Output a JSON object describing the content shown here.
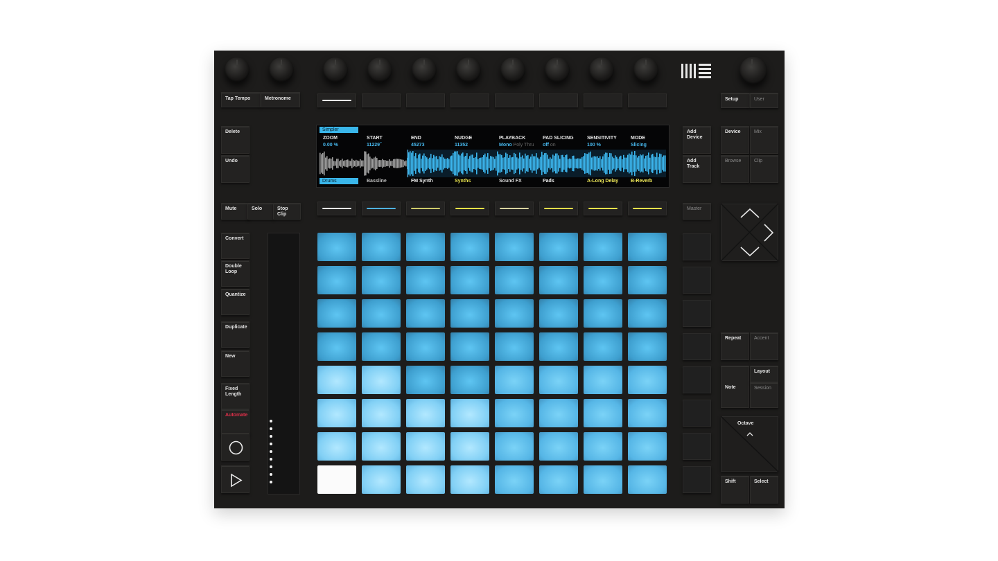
{
  "controller": {
    "logo": "ableton-logo",
    "top_left_buttons": [
      "Tap Tempo",
      "Metronome"
    ],
    "right_top": {
      "setup": "Setup",
      "user": "User"
    },
    "left_buttons": {
      "delete": "Delete",
      "undo": "Undo",
      "mute": "Mute",
      "solo": "Solo",
      "stop_clip": "Stop\nClip",
      "convert": "Convert",
      "double_loop": "Double\nLoop",
      "quantize": "Quantize",
      "duplicate": "Duplicate",
      "new": "New",
      "fixed_length": "Fixed\nLength",
      "automate": "Automate",
      "record_icon": "record-icon",
      "play_icon": "play-icon"
    },
    "screen": {
      "device_tag": "Simpler",
      "track_tag": "Drums",
      "params": [
        {
          "name": "ZOOM",
          "value": "0.00 %"
        },
        {
          "name": "START",
          "value": "11229˝"
        },
        {
          "name": "END",
          "value": "45273"
        },
        {
          "name": "NUDGE",
          "value": "11352"
        },
        {
          "name": "PLAYBACK",
          "value": "Mono",
          "extra": "Poly Thru"
        },
        {
          "name": "PAD SLICING",
          "value": "off",
          "extra": "on"
        },
        {
          "name": "SENSITIVITY",
          "value": "100 %"
        },
        {
          "name": "MODE",
          "value": "Slicing"
        }
      ],
      "tracks": [
        "Drums",
        "Bassline",
        "FM Synth",
        "Synths",
        "Sound FX",
        "Pads",
        "A-Long Delay",
        "B-Reverb"
      ],
      "track_colors": [
        "#3ab6ea",
        "#bdbdbd",
        "#f0f0f0",
        "#e6e04c",
        "#d8d8d8",
        "#f0f0f0",
        "#f2ec5a",
        "#f2ec5a"
      ]
    },
    "right_buttons": {
      "add_device": "Add\nDevice",
      "add_track": "Add\nTrack",
      "device": "Device",
      "mix": "Mix",
      "browse": "Browse",
      "clip": "Clip",
      "master": "Master",
      "repeat": "Repeat",
      "accent": "Accent",
      "layout": "Layout",
      "note": "Note",
      "session": "Session",
      "octave": "Octave",
      "shift": "Shift",
      "select": "Select",
      "arrow_up": "chevron-up-icon",
      "arrow_right": "chevron-right-icon",
      "arrow_down": "chevron-down-icon",
      "octave_up": "chevron-up-icon"
    },
    "track_select_colors": [
      "#f4f4f4",
      "#4fb2e0",
      "#cfcb6b",
      "#e8e248",
      "#d9d4a0",
      "#e3dd4a",
      "#e8e24c",
      "#e8e24c"
    ],
    "pad_colors": {
      "dim": "#4aa6d6",
      "mid": "#63bdeb",
      "bright": "#9bdcfb",
      "white": "#fbfbfb"
    },
    "touch_strip_dots": 9
  }
}
